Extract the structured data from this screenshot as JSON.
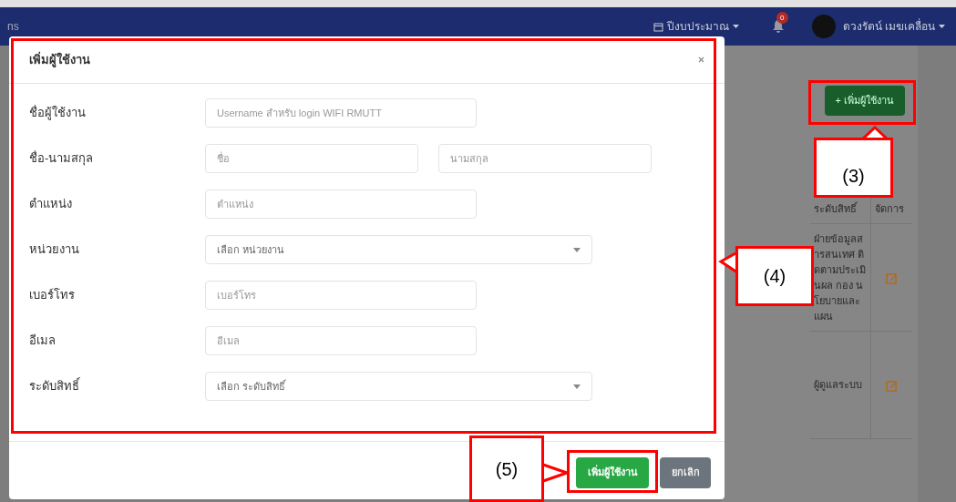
{
  "navbar": {
    "brand_fragment": "ns",
    "fiscal_year_label": "ปีงบประมาณ",
    "notification_count": "0",
    "user_name": "ดวงรัตน์ เมฆเคลื่อน"
  },
  "page": {
    "add_button": "+ เพิ่มผู้ใช้งาน",
    "table": {
      "columns": [
        "ระดับสิทธิ์",
        "จัดการ"
      ],
      "rows": [
        {
          "permission": "ฝ่ายข้อมูลสารสนเทศ ติดตามประเมินผล กอง นโยบายและแผน"
        },
        {
          "permission": "ผู้ดูแลระบบ"
        }
      ]
    }
  },
  "modal": {
    "title": "เพิ่มผู้ใช้งาน",
    "fields": [
      {
        "label": "ชื่อผู้ใช้งาน",
        "kind": "text",
        "inputs": [
          {
            "placeholder": "Username สำหรับ login WIFI RMUTT"
          }
        ]
      },
      {
        "label": "ชื่อ-นามสกุล",
        "kind": "pair",
        "inputs": [
          {
            "placeholder": "ชื่อ"
          },
          {
            "placeholder": "นามสกุล"
          }
        ]
      },
      {
        "label": "ตำแหน่ง",
        "kind": "text",
        "inputs": [
          {
            "placeholder": "ตำแหน่ง"
          }
        ]
      },
      {
        "label": "หน่วยงาน",
        "kind": "select",
        "value": "เลือก หน่วยงาน"
      },
      {
        "label": "เบอร์โทร",
        "kind": "text",
        "inputs": [
          {
            "placeholder": "เบอร์โทร"
          }
        ]
      },
      {
        "label": "อีเมล",
        "kind": "text",
        "inputs": [
          {
            "placeholder": "อีเมล"
          }
        ]
      },
      {
        "label": "ระดับสิทธิ์",
        "kind": "select",
        "value": "เลือก ระดับสิทธิ์"
      }
    ],
    "buttons": [
      {
        "label": "เพิ่มผู้ใช้งาน",
        "kind": "primary"
      },
      {
        "label": "ยกเลิก",
        "kind": "secondary"
      }
    ]
  },
  "annotations": [
    {
      "label": "(3)"
    },
    {
      "label": "(4)"
    },
    {
      "label": "(5)"
    }
  ]
}
